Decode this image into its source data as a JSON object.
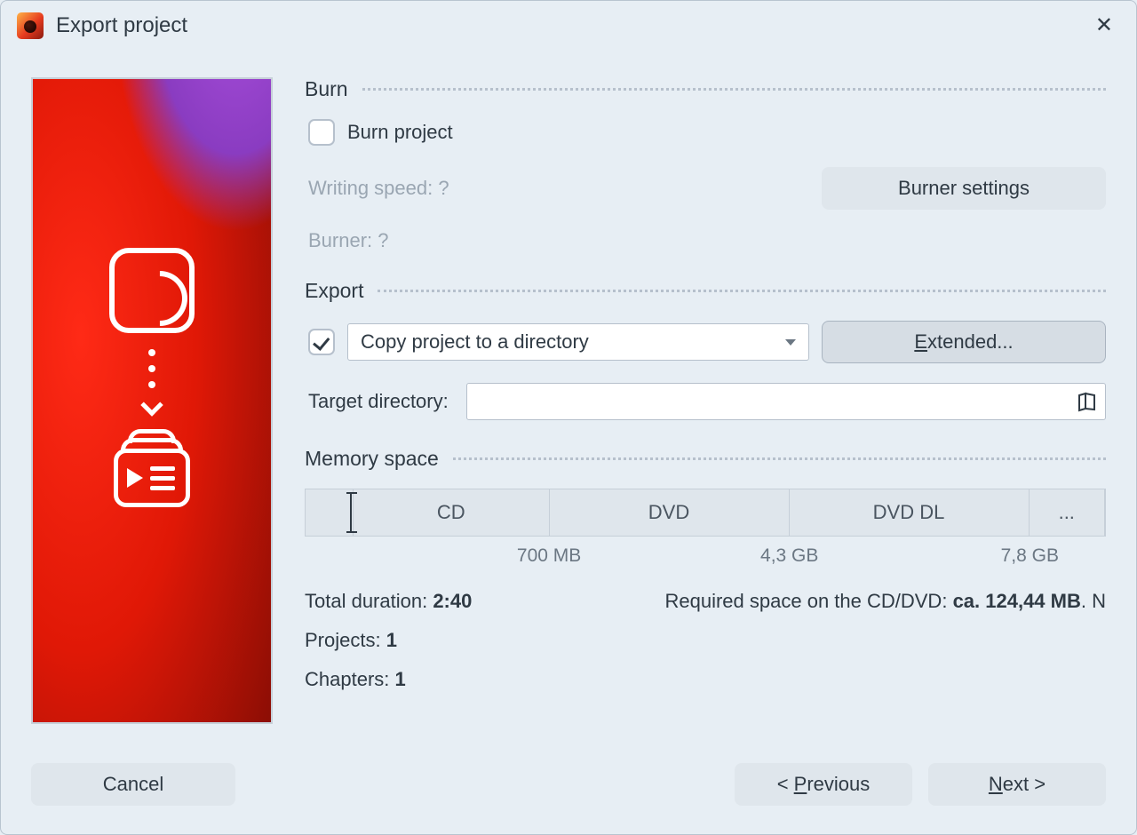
{
  "window": {
    "title": "Export project"
  },
  "burn": {
    "heading": "Burn",
    "project_label": "Burn project",
    "project_checked": false,
    "writing_speed_label": "Writing speed: ?",
    "burner_label": "Burner: ?",
    "settings_button": "Burner settings"
  },
  "export": {
    "heading": "Export",
    "copy_checked": true,
    "combo_value": "Copy project to a directory",
    "extended_button_prefix": "E",
    "extended_button_suffix": "xtended...",
    "target_dir_label": "Target directory:",
    "target_dir_value": ""
  },
  "memory": {
    "heading": "Memory space",
    "segments": [
      {
        "label": "",
        "width_pct": 6.0
      },
      {
        "label": "CD",
        "width_pct": 24.5
      },
      {
        "label": "DVD",
        "width_pct": 30.0
      },
      {
        "label": "DVD DL",
        "width_pct": 30.0
      },
      {
        "label": "...",
        "width_pct": 9.5
      }
    ],
    "cursor_pct": 5.5,
    "ticks": [
      {
        "label": "700 MB",
        "pos_pct": 30.5
      },
      {
        "label": "4,3 GB",
        "pos_pct": 60.5
      },
      {
        "label": "7,8 GB",
        "pos_pct": 90.5
      }
    ]
  },
  "stats": {
    "total_duration_label": "Total duration: ",
    "total_duration_value": "2:40",
    "required_label": "Required space on the CD/DVD: ",
    "required_value": "ca. 124,44 MB",
    "required_suffix": ". N",
    "projects_label": "Projects: ",
    "projects_value": "1",
    "chapters_label": "Chapters: ",
    "chapters_value": "1"
  },
  "footer": {
    "cancel": "Cancel",
    "prev_prefix": "< ",
    "prev_u": "P",
    "prev_suffix": "revious",
    "next_u": "N",
    "next_suffix": "ext >"
  }
}
